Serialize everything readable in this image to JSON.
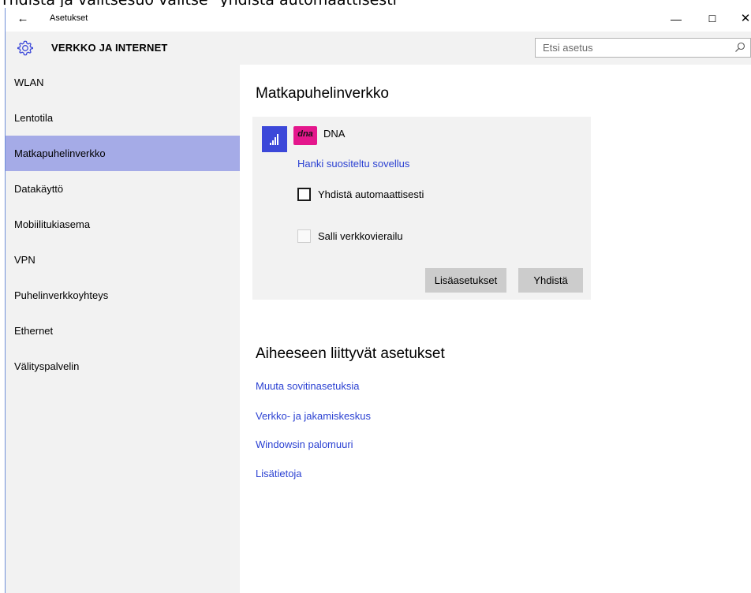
{
  "caption": "Yhdistä ja valitsesuo valitse \"yhdistä automaattisesti\"",
  "window": {
    "app_title": "Asetukset",
    "back_glyph": "←",
    "minimize_glyph": "—",
    "maximize_glyph": "☐",
    "close_glyph": "✕"
  },
  "header": {
    "section_title": "VERKKO JA INTERNET",
    "search_placeholder": "Etsi asetus"
  },
  "sidebar": {
    "items": [
      {
        "label": "WLAN",
        "selected": false
      },
      {
        "label": "Lentotila",
        "selected": false
      },
      {
        "label": "Matkapuhelinverkko",
        "selected": true
      },
      {
        "label": "Datakäyttö",
        "selected": false
      },
      {
        "label": "Mobiilitukiasema",
        "selected": false
      },
      {
        "label": "VPN",
        "selected": false
      },
      {
        "label": "Puhelinverkkoyhteys",
        "selected": false
      },
      {
        "label": "Ethernet",
        "selected": false
      },
      {
        "label": "Välityspalvelin",
        "selected": false
      }
    ]
  },
  "main": {
    "heading": "Matkapuhelinverkko",
    "network": {
      "operator": "DNA",
      "logo_text": "dna",
      "app_link": "Hanki suositeltu sovellus",
      "auto_connect_label": "Yhdistä automaattisesti",
      "auto_connect_checked": false,
      "roaming_label": "Salli verkkovierailu",
      "roaming_checked": false,
      "roaming_enabled": false,
      "advanced_button": "Lisäasetukset",
      "connect_button": "Yhdistä"
    },
    "related_heading": "Aiheeseen liittyvät asetukset",
    "related_links": [
      "Muuta sovitinasetuksia",
      "Verkko- ja jakamiskeskus",
      "Windowsin palomuuri",
      "Lisätietoja"
    ]
  },
  "colors": {
    "accent": "#3c48d9",
    "link": "#2b41d2",
    "selection": "#a5abe7",
    "brand_pink": "#e4168c",
    "panel": "#f2f2f2",
    "button": "#cccccc"
  }
}
